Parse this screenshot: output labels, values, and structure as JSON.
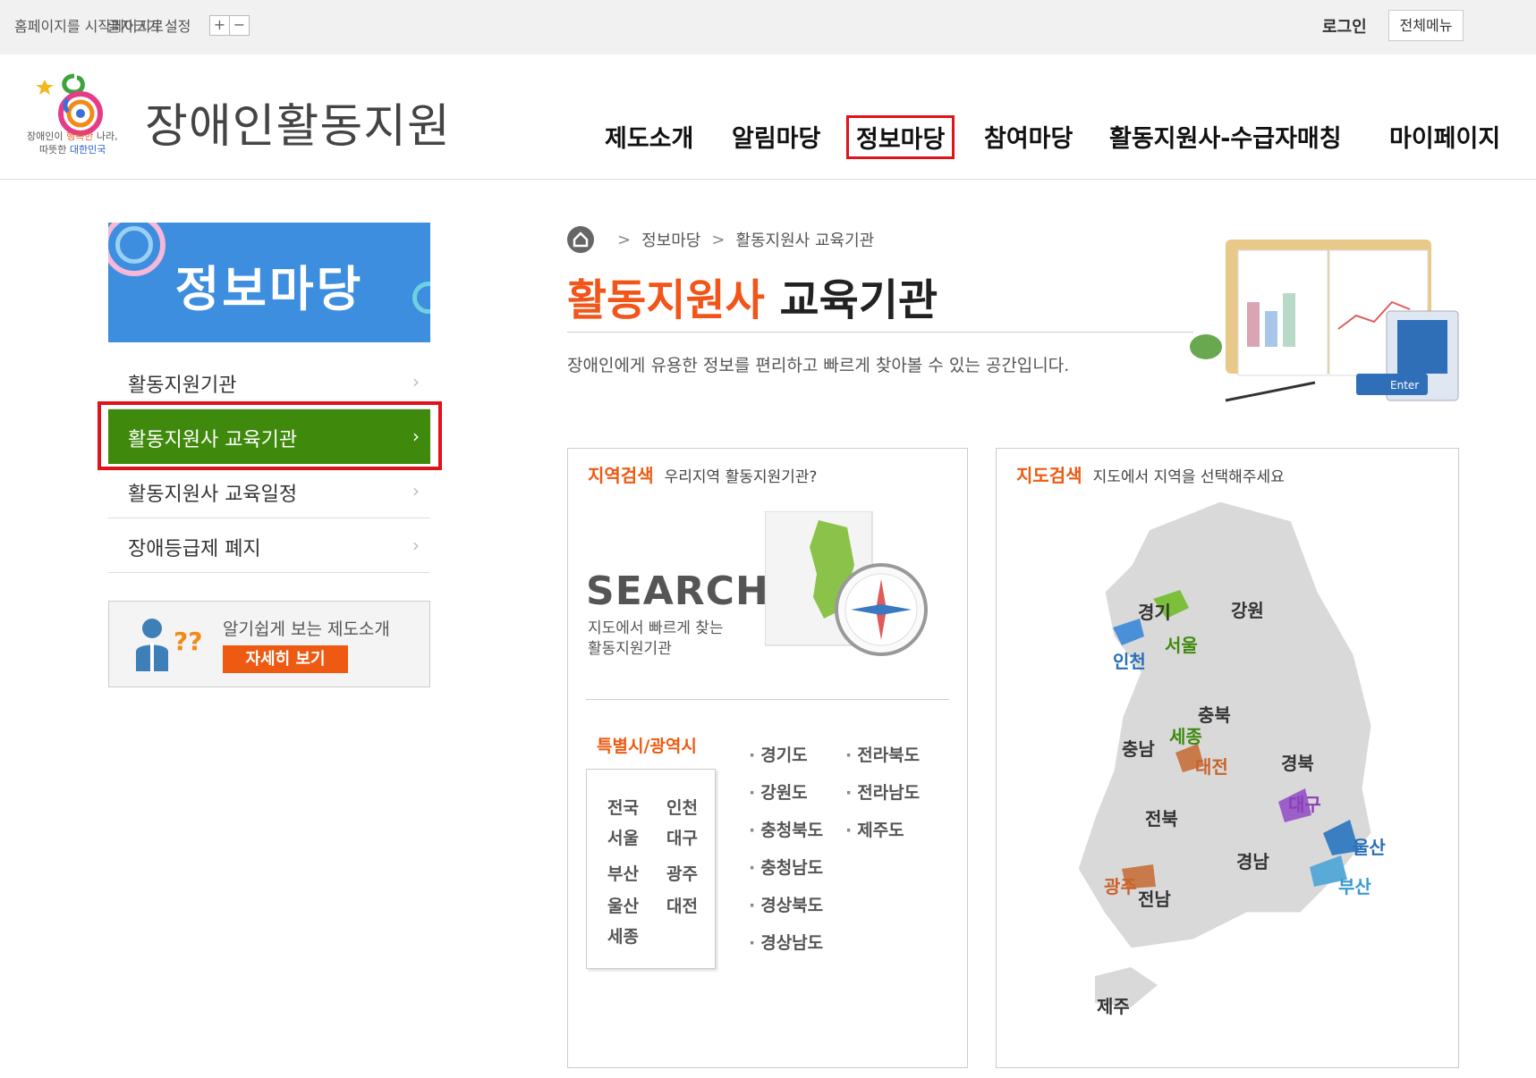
{
  "utility": {
    "left_text": "홈페이지를 시작페이지로",
    "left_text2": "글자크기 설정",
    "font_plus": "+",
    "font_minus": "−",
    "login": "로그인",
    "all_menu": "전체메뉴"
  },
  "brand": {
    "title": "장애인활동지원",
    "tagline_1a": "장애인이 ",
    "tagline_1b": "행복한",
    "tagline_1c": " 나라,",
    "tagline_2a": "따뜻한 ",
    "tagline_2b": "대한민국"
  },
  "gnb": [
    {
      "label": "제도소개"
    },
    {
      "label": "알림마당"
    },
    {
      "label": "정보마당",
      "active": true
    },
    {
      "label": "참여마당"
    },
    {
      "label": "활동지원사-수급자매칭"
    },
    {
      "label": "마이페이지"
    }
  ],
  "sidebar": {
    "banner_title": "정보마당",
    "items": [
      {
        "label": "활동지원기관"
      },
      {
        "label": "활동지원사 교육기관",
        "active": true
      },
      {
        "label": "활동지원사 교육일정"
      },
      {
        "label": "장애등급제 폐지"
      }
    ],
    "arrow": "›",
    "guide_text": "알기쉽게 보는 제도소개",
    "guide_button": "자세히 보기"
  },
  "breadcrumb": [
    "정보마당",
    "활동지원사 교육기관"
  ],
  "breadcrumb_sep": ">",
  "page": {
    "title_highlight": "활동지원사",
    "title_rest": " 교육기관",
    "description": "장애인에게 유용한 정보를 편리하고 빠르게 찾아볼 수 있는 공간입니다.",
    "art_enter": "Enter"
  },
  "region_search": {
    "head": "지역검색",
    "sub": "우리지역 활동지원기관?",
    "search_word": "SEARCH",
    "search_sub_1": "지도에서 빠르게 찾는",
    "search_sub_2": "활동지원기관",
    "metro_title": "특별시/광역시",
    "metros": [
      "전국",
      "인천",
      "서울",
      "대구",
      "부산",
      "광주",
      "울산",
      "대전",
      "세종"
    ],
    "provinces": [
      "경기도",
      "강원도",
      "충청북도",
      "충청남도",
      "경상북도",
      "경상남도",
      "전라북도",
      "전라남도",
      "제주도"
    ]
  },
  "map_search": {
    "head": "지도검색",
    "sub": "지도에서 지역을 선택해주세요",
    "regions": {
      "gyeonggi": "경기",
      "gangwon": "강원",
      "seoul": "서울",
      "incheon": "인천",
      "chungbuk": "충북",
      "sejong": "세종",
      "chungnam": "충남",
      "daejeon": "대전",
      "gyeongbuk": "경북",
      "jeonbuk": "전북",
      "daegu": "대구",
      "ulsan": "울산",
      "gyeongnam": "경남",
      "gwangju": "광주",
      "busan": "부산",
      "jeonnam": "전남",
      "jeju": "제주"
    }
  }
}
